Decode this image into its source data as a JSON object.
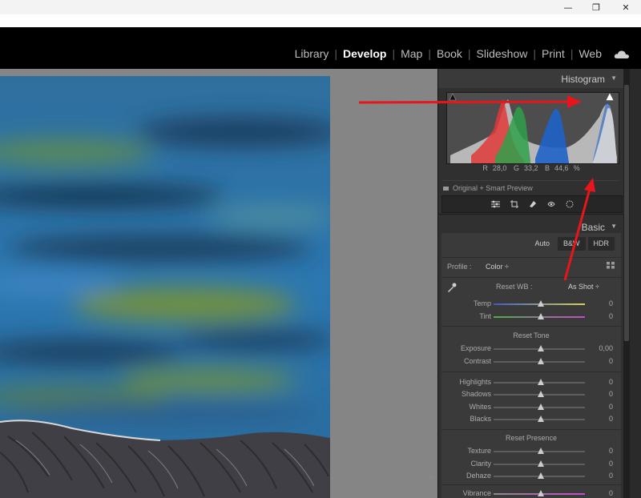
{
  "window_controls": {
    "minimize": "—",
    "maximize": "❐",
    "close": "✕"
  },
  "modules": [
    {
      "label": "Library"
    },
    {
      "label": "Develop"
    },
    {
      "label": "Map"
    },
    {
      "label": "Book"
    },
    {
      "label": "Slideshow"
    },
    {
      "label": "Print"
    },
    {
      "label": "Web"
    }
  ],
  "histogram": {
    "title": "Histogram",
    "readout": {
      "r_label": "R",
      "r_value": "28,0",
      "g_label": "G",
      "g_value": "33,2",
      "b_label": "B",
      "b_value": "44,6",
      "unit": "%"
    },
    "preview_text": "Original + Smart Preview"
  },
  "basic": {
    "title": "Basic",
    "treatment_buttons": {
      "auto": "Auto",
      "bw": "B&W",
      "hdr": "HDR"
    },
    "profile": {
      "label": "Profile :",
      "value": "Color ÷"
    },
    "wb": {
      "label": "Reset WB :",
      "value": "As Shot ÷"
    },
    "groups": {
      "tone": "Reset Tone",
      "presence": "Reset Presence"
    },
    "sliders": [
      {
        "label": "Temp",
        "value": "0"
      },
      {
        "label": "Tint",
        "value": "0"
      },
      {
        "label": "Exposure",
        "value": "0,00"
      },
      {
        "label": "Contrast",
        "value": "0"
      },
      {
        "label": "Highlights",
        "value": "0"
      },
      {
        "label": "Shadows",
        "value": "0"
      },
      {
        "label": "Whites",
        "value": "0"
      },
      {
        "label": "Blacks",
        "value": "0"
      },
      {
        "label": "Texture",
        "value": "0"
      },
      {
        "label": "Clarity",
        "value": "0"
      },
      {
        "label": "Dehaze",
        "value": "0"
      },
      {
        "label": "Vibrance",
        "value": "0"
      }
    ]
  },
  "icons": [
    "cloud-icon",
    "sliders-icon",
    "crop-icon",
    "heal-icon",
    "redeye-icon",
    "masking-icon",
    "eyedropper-icon",
    "profile-browser-icon",
    "panel-collapse-icon"
  ],
  "colors": {
    "annotation_arrow": "#e8161b",
    "histogram_red": "#e03a3a",
    "histogram_green": "#2fa04a",
    "histogram_blue": "#1f63c8",
    "histogram_lum": "#c9c9c9"
  }
}
